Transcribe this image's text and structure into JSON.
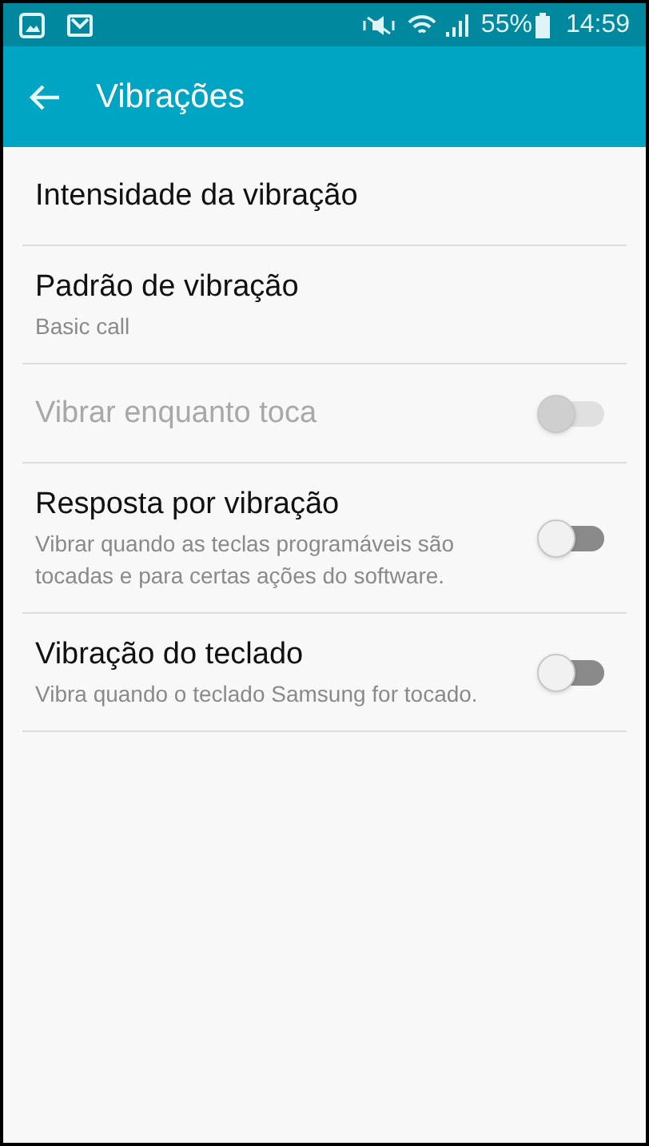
{
  "status_bar": {
    "battery": "55%",
    "time": "14:59"
  },
  "app_bar": {
    "title": "Vibrações"
  },
  "items": [
    {
      "kind": "link",
      "title": "Intensidade da vibração"
    },
    {
      "kind": "link",
      "title": "Padrão de vibração",
      "summary": "Basic call"
    },
    {
      "kind": "toggle",
      "title": "Vibrar enquanto toca",
      "on": false,
      "disabled": true
    },
    {
      "kind": "toggle",
      "title": "Resposta por vibração",
      "summary": "Vibrar quando as teclas programáveis são tocadas e para certas ações do software.",
      "on": false,
      "disabled": false
    },
    {
      "kind": "toggle",
      "title": "Vibração do teclado",
      "summary": "Vibra quando o teclado Samsung for tocado.",
      "on": false,
      "disabled": false
    }
  ]
}
